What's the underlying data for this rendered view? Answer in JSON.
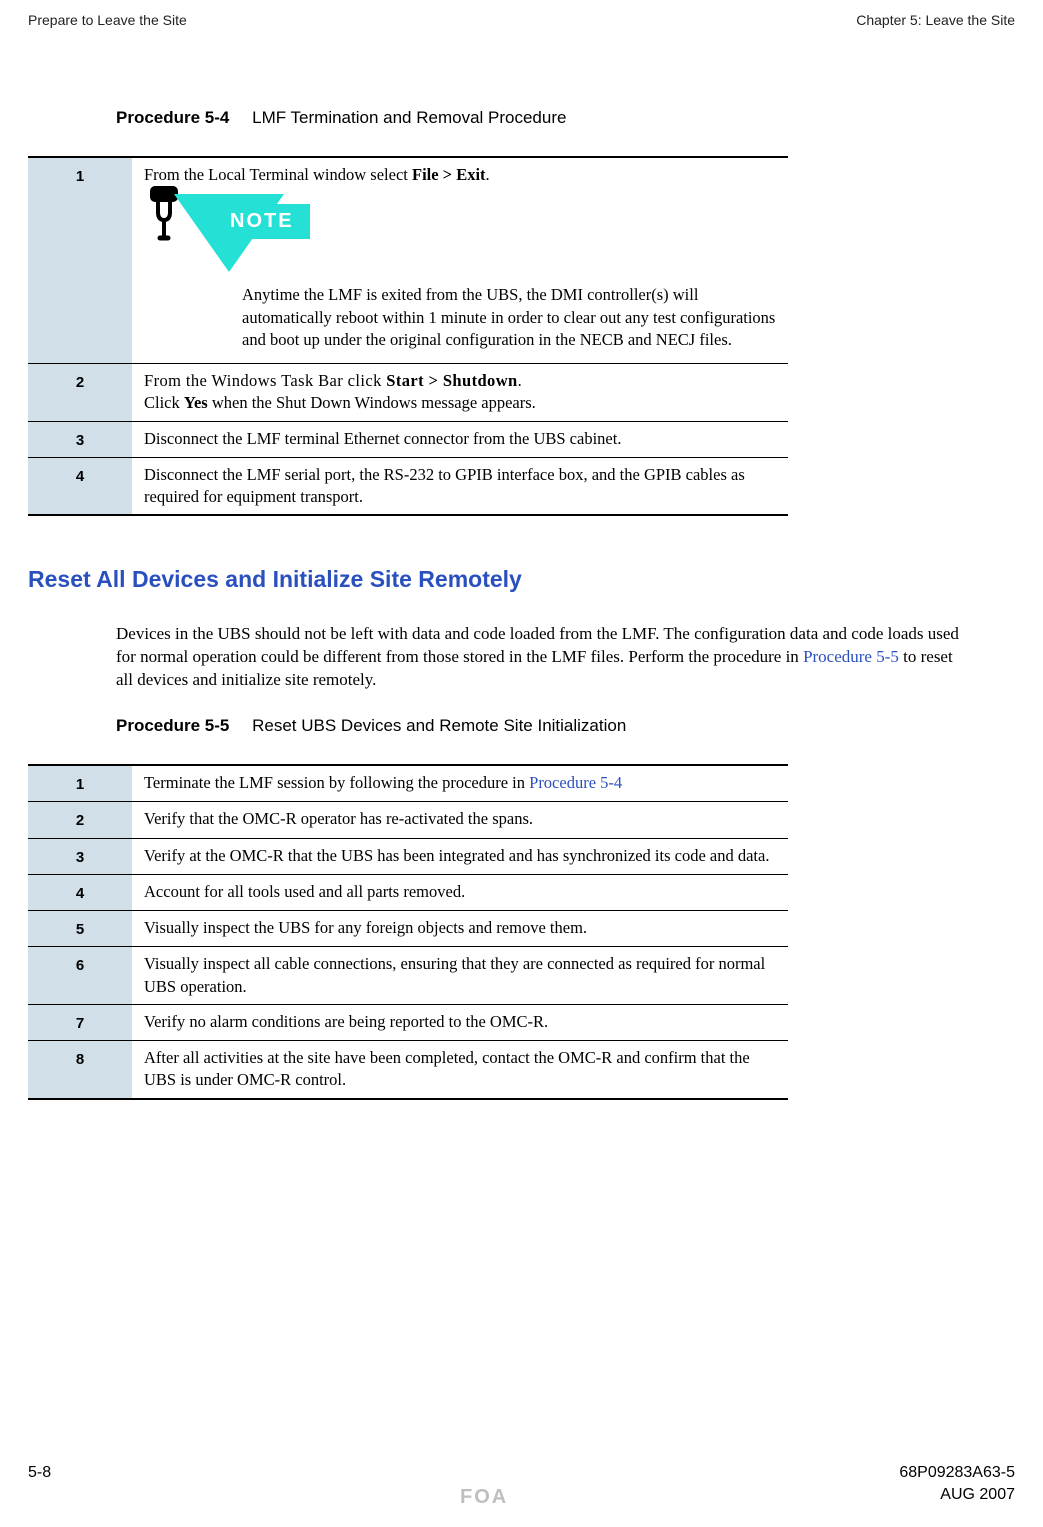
{
  "header": {
    "left": "Prepare to Leave the Site",
    "right": "Chapter 5: Leave the Site"
  },
  "procedure54": {
    "caption_num": "Procedure 5-4",
    "caption_title": "LMF Termination and Removal Procedure",
    "steps": [
      {
        "num": "1",
        "text_a": "From the Local Terminal window select ",
        "bold_a": "File > Exit",
        "text_b": ".",
        "note_label": "NOTE",
        "note_body": "Anytime the LMF is exited from the UBS, the DMI controller(s) will automatically reboot within 1 minute in order to clear out any test configurations and boot up under the original configuration in the NECB and NECJ files."
      },
      {
        "num": "2",
        "line1_a": "From the Windows Task Bar click ",
        "line1_b": "Start > Shutdown",
        "line1_c": ".",
        "line2_a": "Click ",
        "line2_b": "Yes",
        "line2_c": " when the Shut Down Windows message appears."
      },
      {
        "num": "3",
        "text": "Disconnect the LMF terminal Ethernet connector from the UBS cabinet."
      },
      {
        "num": "4",
        "text": "Disconnect the LMF serial port, the RS-232 to GPIB interface box, and the GPIB cables as required for equipment transport."
      }
    ]
  },
  "section": {
    "heading": "Reset All Devices and Initialize Site Remotely",
    "para_a": "Devices in the UBS should not be left with data and code loaded from the LMF. The configuration data and code loads used for normal operation could be different from those stored in the LMF files. Perform the procedure in ",
    "para_link": "Procedure 5-5",
    "para_b": " to reset all devices and initialize site remotely."
  },
  "procedure55": {
    "caption_num": "Procedure 5-5",
    "caption_title": "Reset UBS Devices and Remote Site Initialization",
    "steps": [
      {
        "num": "1",
        "text_a": "Terminate the LMF session by following the procedure in ",
        "link": "Procedure 5-4"
      },
      {
        "num": "2",
        "text": "Verify that the OMC-R operator has re-activated the spans."
      },
      {
        "num": "3",
        "text": "Verify at the OMC-R that the UBS has been integrated and has synchronized its code and data."
      },
      {
        "num": "4",
        "text": "Account for all tools used and all parts removed."
      },
      {
        "num": "5",
        "text": "Visually inspect the UBS for any foreign objects and remove them."
      },
      {
        "num": "6",
        "text": "Visually inspect all cable connections, ensuring that they are connected as required for normal UBS operation."
      },
      {
        "num": "7",
        "text": "Verify no alarm conditions are being reported to the OMC-R."
      },
      {
        "num": "8",
        "text": "After all activities at the site have been completed, contact the OMC-R and confirm that the UBS is under OMC-R control."
      }
    ]
  },
  "footer": {
    "page": "5-8",
    "docnum": "68P09283A63-5",
    "foa": "FOA",
    "date": "AUG 2007"
  }
}
